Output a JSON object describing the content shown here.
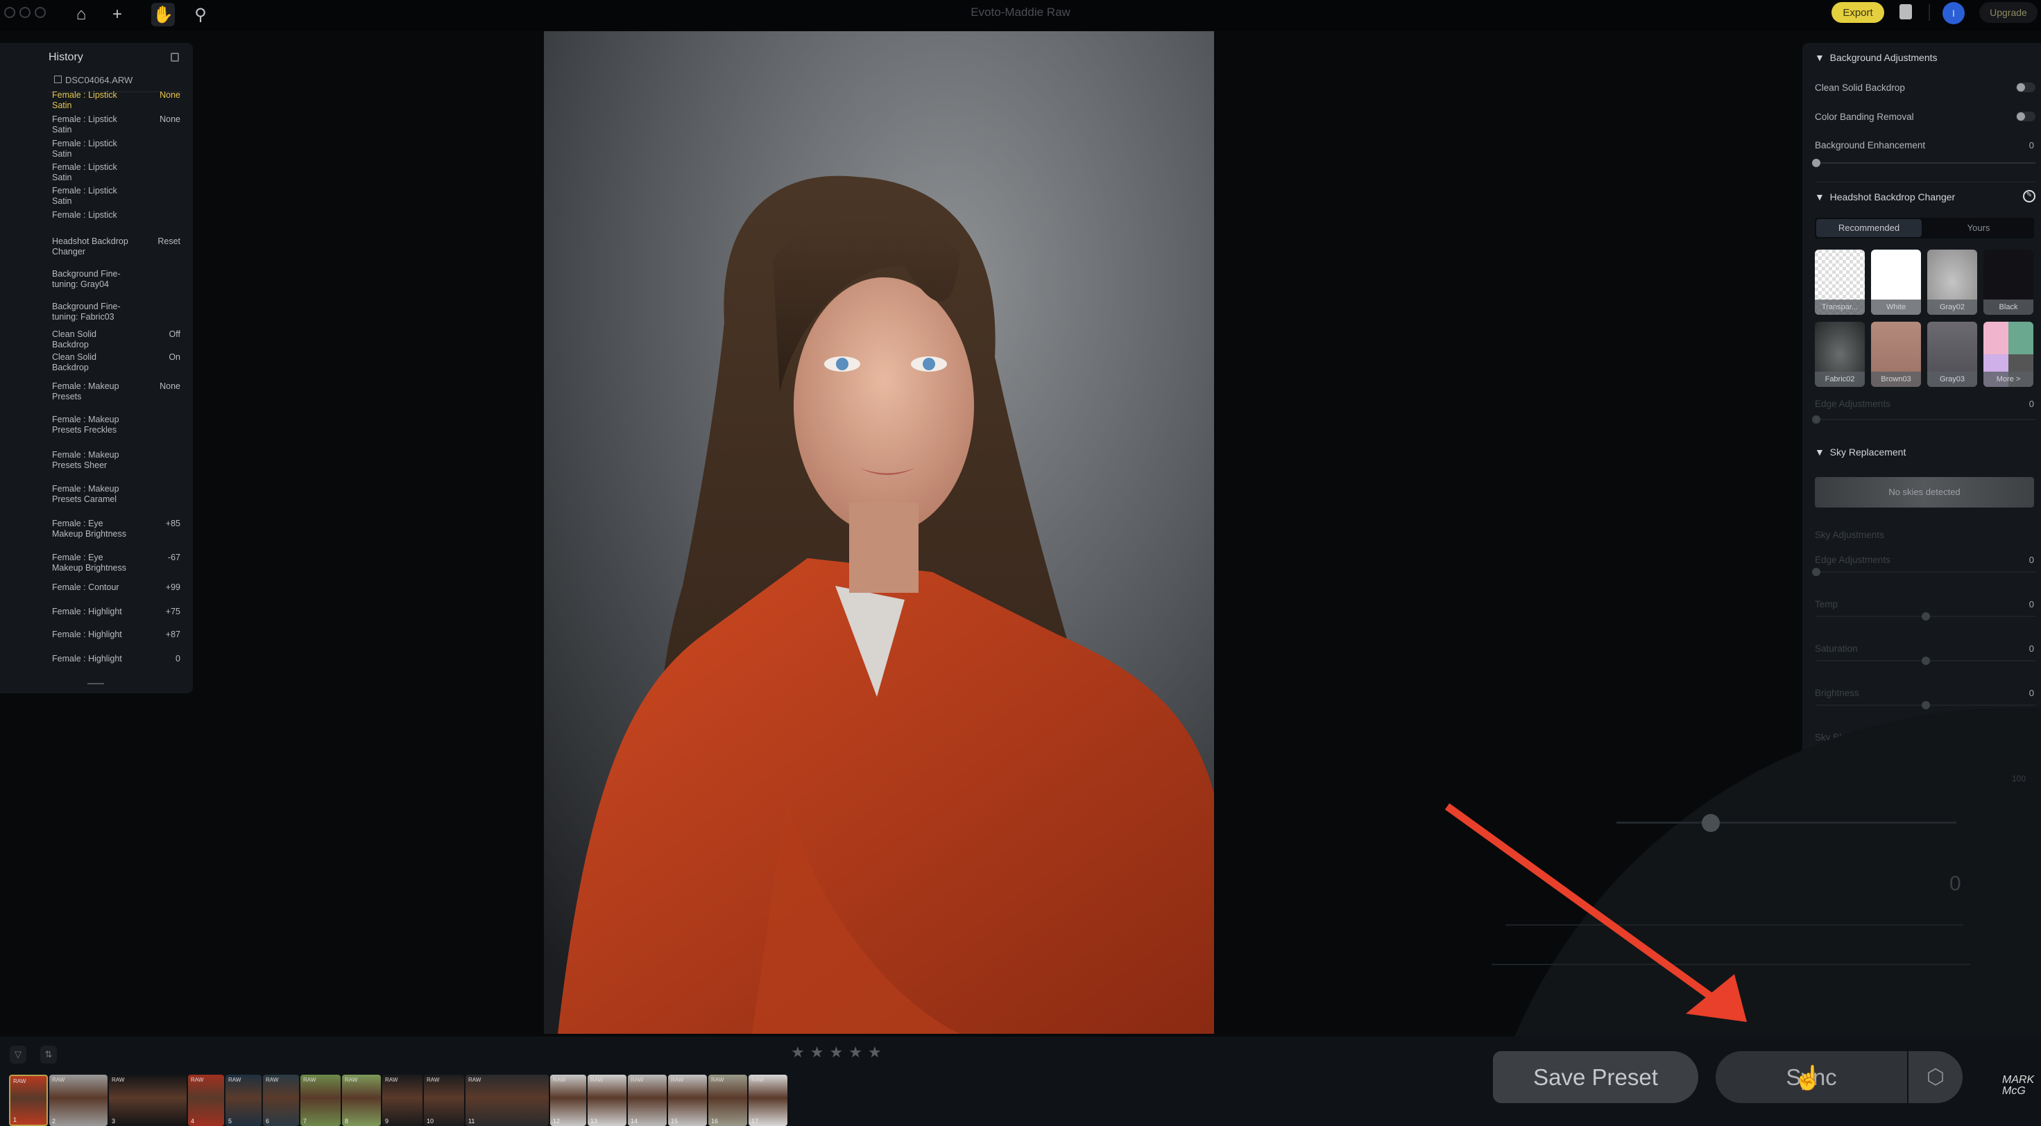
{
  "app": {
    "title": "Evoto-Maddie Raw",
    "export_label": "Export",
    "upgrade_label": "Upgrade",
    "avatar_initial": "I"
  },
  "history": {
    "title": "History",
    "filename": "DSC04064.ARW",
    "rows": [
      {
        "label": "Female : Lipstick Satin",
        "value": "None",
        "active": true
      },
      {
        "label": "Female : Lipstick Satin",
        "value": "None"
      },
      {
        "label": "Female : Lipstick Satin",
        "value": ""
      },
      {
        "label": "Female : Lipstick Satin",
        "value": ""
      },
      {
        "label": "Female : Lipstick Satin",
        "value": ""
      },
      {
        "label": "Female : Lipstick",
        "value": ""
      },
      {
        "label": "Headshot Backdrop Changer",
        "value": "Reset"
      },
      {
        "label": "Background Fine-tuning: Gray04",
        "value": ""
      },
      {
        "label": "Background Fine-tuning: Fabric03",
        "value": ""
      },
      {
        "label": "Clean Solid Backdrop",
        "value": "Off"
      },
      {
        "label": "Clean Solid Backdrop",
        "value": "On"
      },
      {
        "label": "Female : Makeup Presets",
        "value": "None"
      },
      {
        "label": "Female : Makeup Presets Freckles",
        "value": ""
      },
      {
        "label": "Female : Makeup Presets Sheer",
        "value": ""
      },
      {
        "label": "Female : Makeup Presets Caramel",
        "value": ""
      },
      {
        "label": "Female : Eye Makeup Brightness",
        "value": "+85"
      },
      {
        "label": "Female : Eye Makeup Brightness",
        "value": "-67"
      },
      {
        "label": "Female : Contour",
        "value": "+99"
      },
      {
        "label": "Female : Highlight",
        "value": "+75"
      },
      {
        "label": "Female : Highlight",
        "value": "+87"
      },
      {
        "label": "Female : Highlight",
        "value": "0"
      }
    ]
  },
  "right_panel": {
    "bg_adjust": {
      "title": "Background Adjustments",
      "clean_solid": "Clean Solid Backdrop",
      "color_banding": "Color Banding Removal",
      "bg_enh": "Background Enhancement",
      "bg_enh_value": "0",
      "clean_solid_on": false,
      "color_banding_on": false
    },
    "backdrop": {
      "title": "Headshot Backdrop Changer",
      "tabs": [
        "Recommended",
        "Yours"
      ],
      "active_tab": "Recommended",
      "swatches": [
        {
          "label": "Transpar..."
        },
        {
          "label": "White"
        },
        {
          "label": "Gray02"
        },
        {
          "label": "Black"
        },
        {
          "label": "Fabric02"
        },
        {
          "label": "Brown03"
        },
        {
          "label": "Gray03"
        },
        {
          "label": "More >"
        }
      ],
      "edge_label": "Edge Adjustments",
      "edge_value": "0"
    },
    "sky": {
      "title": "Sky Replacement",
      "no_skies": "No skies detected",
      "adjust_title": "Sky Adjustments",
      "sliders": [
        {
          "label": "Edge Adjustments",
          "value": "0"
        },
        {
          "label": "Temp",
          "value": "0"
        },
        {
          "label": "Saturation",
          "value": "0"
        },
        {
          "label": "Brightness",
          "value": "0"
        },
        {
          "label": "Sky Blur",
          "value": "0"
        }
      ]
    }
  },
  "loupe": {
    "value": "0",
    "top_value": "100"
  },
  "actions": {
    "save_preset": "Save Preset",
    "sync": "Sync"
  },
  "rating": {
    "stars": 5,
    "value": 0
  },
  "filmstrip": [
    {
      "n": "1",
      "badge": "RAW",
      "selected": true
    },
    {
      "n": "2",
      "badge": "RAW"
    },
    {
      "n": "3",
      "badge": "RAW"
    },
    {
      "n": "4",
      "badge": "RAW"
    },
    {
      "n": "5",
      "badge": "RAW"
    },
    {
      "n": "6",
      "badge": "RAW"
    },
    {
      "n": "7",
      "badge": "RAW"
    },
    {
      "n": "8",
      "badge": "RAW"
    },
    {
      "n": "9",
      "badge": "RAW"
    },
    {
      "n": "10",
      "badge": "RAW"
    },
    {
      "n": "11",
      "badge": "RAW"
    },
    {
      "n": "12",
      "badge": "RAW"
    },
    {
      "n": "13",
      "badge": "RAW"
    },
    {
      "n": "14",
      "badge": "RAW"
    },
    {
      "n": "15",
      "badge": "RAW"
    },
    {
      "n": "16",
      "badge": "RAW"
    },
    {
      "n": "17",
      "badge": "RAW"
    }
  ],
  "watermark": "MARK McG",
  "colors": {
    "accent": "#e4cf3e",
    "history_active": "#e6c652",
    "annotation_arrow": "#e8402a"
  }
}
